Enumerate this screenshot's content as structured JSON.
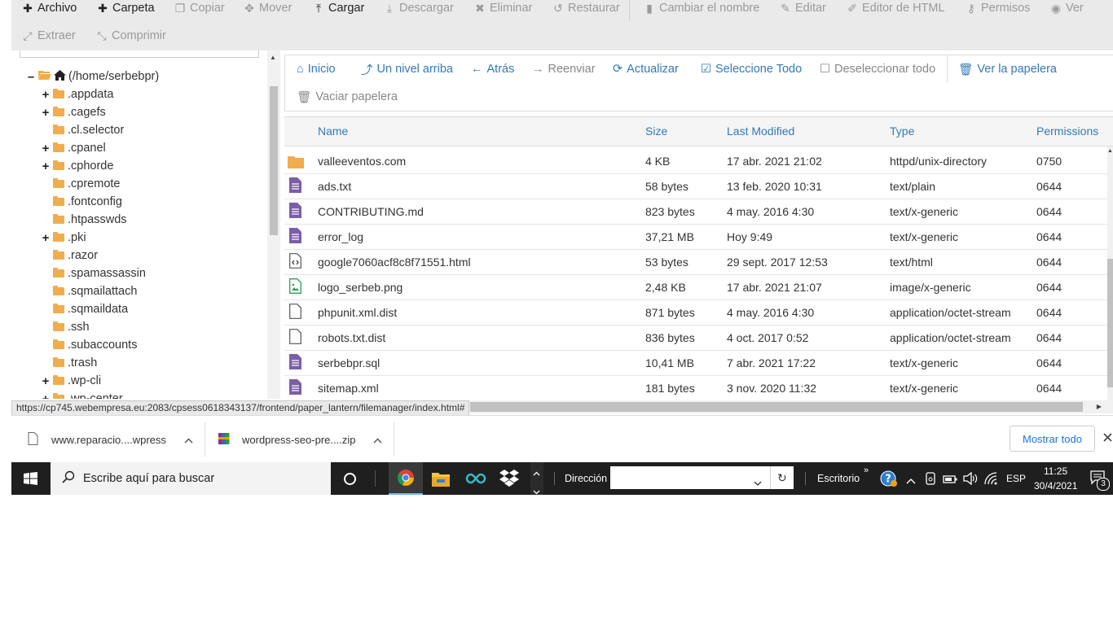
{
  "toolbar": {
    "row1": [
      {
        "icon": "plus",
        "label": "Archivo",
        "enabled": true
      },
      {
        "icon": "plus",
        "label": "Carpeta",
        "enabled": true
      },
      {
        "icon": "copy",
        "label": "Copiar",
        "enabled": false
      },
      {
        "icon": "move",
        "label": "Mover",
        "enabled": false
      },
      {
        "icon": "upload",
        "label": "Cargar",
        "enabled": true
      },
      {
        "icon": "download",
        "label": "Descargar",
        "enabled": false
      },
      {
        "icon": "times",
        "label": "Eliminar",
        "enabled": false
      },
      {
        "icon": "undo",
        "label": "Restaurar",
        "enabled": false
      },
      {
        "icon": "file",
        "label": "Cambiar el nombre",
        "enabled": false
      },
      {
        "icon": "pencil",
        "label": "Editar",
        "enabled": false
      },
      {
        "icon": "edit",
        "label": "Editor de HTML",
        "enabled": false
      },
      {
        "icon": "key",
        "label": "Permisos",
        "enabled": false
      },
      {
        "icon": "eye",
        "label": "Ver",
        "enabled": false
      }
    ],
    "row2": [
      {
        "icon": "expand",
        "label": "Extraer",
        "enabled": false
      },
      {
        "icon": "compress",
        "label": "Comprimir",
        "enabled": false
      }
    ]
  },
  "tree": {
    "root": "(/home/serbebpr)",
    "items": [
      {
        "label": ".appdata",
        "expandable": true
      },
      {
        "label": ".cagefs",
        "expandable": true
      },
      {
        "label": ".cl.selector",
        "expandable": false
      },
      {
        "label": ".cpanel",
        "expandable": true
      },
      {
        "label": ".cphorde",
        "expandable": true
      },
      {
        "label": ".cpremote",
        "expandable": false
      },
      {
        "label": ".fontconfig",
        "expandable": false
      },
      {
        "label": ".htpasswds",
        "expandable": false
      },
      {
        "label": ".pki",
        "expandable": true
      },
      {
        "label": ".razor",
        "expandable": false
      },
      {
        "label": ".spamassassin",
        "expandable": false
      },
      {
        "label": ".sqmailattach",
        "expandable": false
      },
      {
        "label": ".sqmaildata",
        "expandable": false
      },
      {
        "label": ".ssh",
        "expandable": false
      },
      {
        "label": ".subaccounts",
        "expandable": false
      },
      {
        "label": ".trash",
        "expandable": false
      },
      {
        "label": ".wp-cli",
        "expandable": true
      },
      {
        "label": ".wp-center",
        "expandable": true
      }
    ]
  },
  "navbar": {
    "row1": [
      {
        "icon": "home",
        "label": "Inicio",
        "enabled": true
      },
      {
        "icon": "level-up",
        "label": "Un nivel arriba",
        "enabled": true
      },
      {
        "icon": "arrow-left",
        "label": "Atrás",
        "enabled": true
      },
      {
        "icon": "arrow-right",
        "label": "Reenviar",
        "enabled": false
      },
      {
        "icon": "refresh",
        "label": "Actualizar",
        "enabled": true
      },
      {
        "icon": "check-square",
        "label": "Seleccione Todo",
        "enabled": true
      },
      {
        "icon": "square",
        "label": "Deseleccionar todo",
        "enabled": false
      },
      {
        "icon": "trash",
        "label": "Ver la papelera",
        "enabled": true
      }
    ],
    "row2": [
      {
        "icon": "trash",
        "label": "Vaciar papelera",
        "enabled": false
      }
    ]
  },
  "table": {
    "columns": [
      "Name",
      "Size",
      "Last Modified",
      "Type",
      "Permissions"
    ],
    "rows": [
      {
        "icon": "folder",
        "name": "valleeventos.com",
        "size": "4 KB",
        "modified": "17 abr. 2021 21:02",
        "type": "httpd/unix-directory",
        "perms": "0750"
      },
      {
        "icon": "text",
        "name": "ads.txt",
        "size": "58 bytes",
        "modified": "13 feb. 2020 10:31",
        "type": "text/plain",
        "perms": "0644"
      },
      {
        "icon": "text",
        "name": "CONTRIBUTING.md",
        "size": "823 bytes",
        "modified": "4 may. 2016 4:30",
        "type": "text/x-generic",
        "perms": "0644"
      },
      {
        "icon": "text",
        "name": "error_log",
        "size": "37,21 MB",
        "modified": "Hoy 9:49",
        "type": "text/x-generic",
        "perms": "0644"
      },
      {
        "icon": "code",
        "name": "google7060acf8c8f71551.html",
        "size": "53 bytes",
        "modified": "29 sept. 2017 12:53",
        "type": "text/html",
        "perms": "0644"
      },
      {
        "icon": "image",
        "name": "logo_serbeb.png",
        "size": "2,48 KB",
        "modified": "17 abr. 2021 21:07",
        "type": "image/x-generic",
        "perms": "0644"
      },
      {
        "icon": "blank",
        "name": "phpunit.xml.dist",
        "size": "871 bytes",
        "modified": "4 may. 2016 4:30",
        "type": "application/octet-stream",
        "perms": "0644"
      },
      {
        "icon": "blank",
        "name": "robots.txt.dist",
        "size": "836 bytes",
        "modified": "4 oct. 2017 0:52",
        "type": "application/octet-stream",
        "perms": "0644"
      },
      {
        "icon": "text",
        "name": "serbebpr.sql",
        "size": "10,41 MB",
        "modified": "7 abr. 2021 17:22",
        "type": "text/x-generic",
        "perms": "0644"
      },
      {
        "icon": "text",
        "name": "sitemap.xml",
        "size": "181 bytes",
        "modified": "3 nov. 2020 11:32",
        "type": "text/x-generic",
        "perms": "0644"
      }
    ]
  },
  "status_url": "https://cp745.webempresa.eu:2083/cpsess0618343137/frontend/paper_lantern/filemanager/index.html#",
  "downloads": {
    "items": [
      "www.reparacio....wpress",
      "wordpress-seo-pre....zip"
    ],
    "show_all": "Mostrar todo"
  },
  "taskbar": {
    "search_placeholder": "Escribe aquí para buscar",
    "address_label": "Dirección",
    "desktop_label": "Escritorio",
    "lang": "ESP",
    "time": "11:25",
    "date": "30/4/2021",
    "notif_count": "3"
  }
}
